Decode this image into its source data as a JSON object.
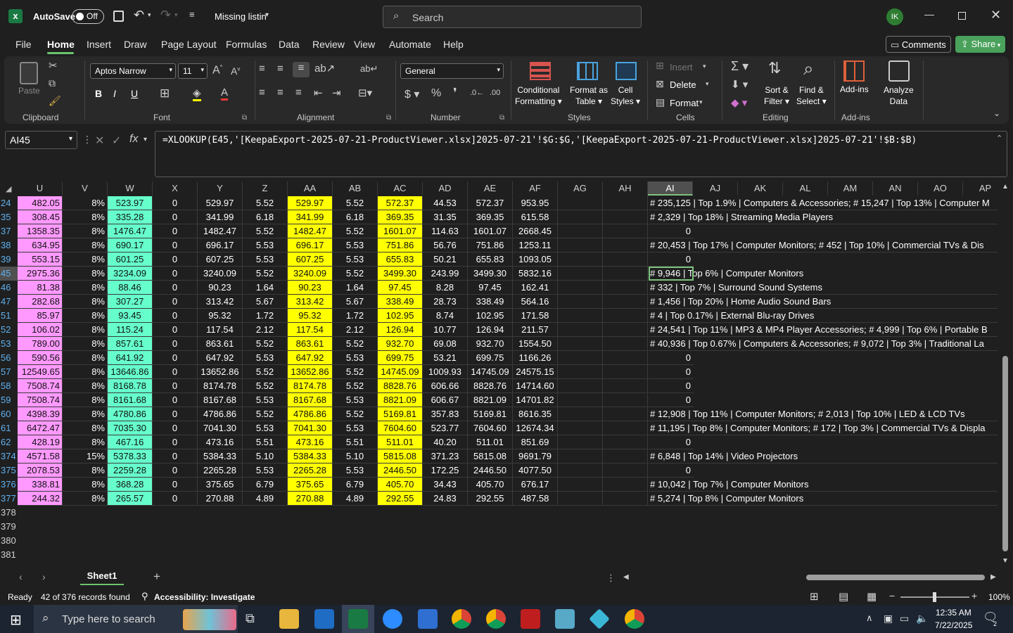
{
  "titlebar": {
    "autosave_label": "AutoSave",
    "autosave_state": "Off",
    "filename": "Missing listin",
    "search_placeholder": "Search",
    "avatar": "IK"
  },
  "menu": [
    "File",
    "Home",
    "Insert",
    "Draw",
    "Page Layout",
    "Formulas",
    "Data",
    "Review",
    "View",
    "Automate",
    "Help"
  ],
  "menu_right": {
    "comments": "Comments",
    "share": "Share"
  },
  "ribbon": {
    "paste": "Paste",
    "font_name": "Aptos Narrow",
    "font_size": "11",
    "number_format": "General",
    "conditional": "Conditional",
    "formatting": "Formatting",
    "format_as": "Format as",
    "table": "Table",
    "cell": "Cell",
    "styles": "Styles",
    "insert": "Insert",
    "delete": "Delete",
    "format": "Format",
    "sort": "Sort &",
    "filter": "Filter",
    "find": "Find &",
    "select": "Select",
    "addins": "Add-ins",
    "analyze": "Analyze",
    "data": "Data",
    "groups": [
      "Clipboard",
      "Font",
      "Alignment",
      "Number",
      "Styles",
      "Cells",
      "Editing",
      "Add-ins"
    ]
  },
  "namebox": "AI45",
  "formula": "=XLOOKUP(E45,'[KeepaExport-2025-07-21-ProductViewer.xlsx]2025-07-21'!$G:$G,'[KeepaExport-2025-07-21-ProductViewer.xlsx]2025-07-21'!$B:$B)",
  "columns": [
    "U",
    "V",
    "W",
    "X",
    "Y",
    "Z",
    "AA",
    "AB",
    "AC",
    "AD",
    "AE",
    "AF",
    "AG",
    "AH",
    "AI",
    "AJ",
    "AK",
    "AL",
    "AM",
    "AN",
    "AO",
    "AP"
  ],
  "rows": [
    {
      "n": "24",
      "u": "482.05",
      "v": "8%",
      "w": "523.97",
      "x": "0",
      "y": "529.97",
      "z": "5.52",
      "aa": "529.97",
      "ab": "5.52",
      "ac": "572.37",
      "ad": "44.53",
      "ae": "572.37",
      "af": "953.95",
      "ai": "# 235,125 | Top 1.9% | Computers & Accessories; # 15,247 | Top 13% | Computer M"
    },
    {
      "n": "35",
      "u": "308.45",
      "v": "8%",
      "w": "335.28",
      "x": "0",
      "y": "341.99",
      "z": "6.18",
      "aa": "341.99",
      "ab": "6.18",
      "ac": "369.35",
      "ad": "31.35",
      "ae": "369.35",
      "af": "615.58",
      "ai": "# 2,329 | Top 18% | Streaming Media Players"
    },
    {
      "n": "37",
      "u": "1358.35",
      "v": "8%",
      "w": "1476.47",
      "x": "0",
      "y": "1482.47",
      "z": "5.52",
      "aa": "1482.47",
      "ab": "5.52",
      "ac": "1601.07",
      "ad": "114.63",
      "ae": "1601.07",
      "af": "2668.45",
      "ai": "0"
    },
    {
      "n": "38",
      "u": "634.95",
      "v": "8%",
      "w": "690.17",
      "x": "0",
      "y": "696.17",
      "z": "5.53",
      "aa": "696.17",
      "ab": "5.53",
      "ac": "751.86",
      "ad": "56.76",
      "ae": "751.86",
      "af": "1253.11",
      "ai": "# 20,453 | Top 17% | Computer Monitors; # 452 | Top 10% | Commercial TVs & Dis"
    },
    {
      "n": "39",
      "u": "553.15",
      "v": "8%",
      "w": "601.25",
      "x": "0",
      "y": "607.25",
      "z": "5.53",
      "aa": "607.25",
      "ab": "5.53",
      "ac": "655.83",
      "ad": "50.21",
      "ae": "655.83",
      "af": "1093.05",
      "ai": "0"
    },
    {
      "n": "45",
      "u": "2975.36",
      "v": "8%",
      "w": "3234.09",
      "x": "0",
      "y": "3240.09",
      "z": "5.52",
      "aa": "3240.09",
      "ab": "5.52",
      "ac": "3499.30",
      "ad": "243.99",
      "ae": "3499.30",
      "af": "5832.16",
      "ai": "# 9,946 | Top 6% | Computer Monitors"
    },
    {
      "n": "46",
      "u": "81.38",
      "v": "8%",
      "w": "88.46",
      "x": "0",
      "y": "90.23",
      "z": "1.64",
      "aa": "90.23",
      "ab": "1.64",
      "ac": "97.45",
      "ad": "8.28",
      "ae": "97.45",
      "af": "162.41",
      "ai": "# 332 | Top 7% | Surround Sound Systems"
    },
    {
      "n": "47",
      "u": "282.68",
      "v": "8%",
      "w": "307.27",
      "x": "0",
      "y": "313.42",
      "z": "5.67",
      "aa": "313.42",
      "ab": "5.67",
      "ac": "338.49",
      "ad": "28.73",
      "ae": "338.49",
      "af": "564.16",
      "ai": "# 1,456 | Top 20% | Home Audio Sound Bars"
    },
    {
      "n": "51",
      "u": "85.97",
      "v": "8%",
      "w": "93.45",
      "x": "0",
      "y": "95.32",
      "z": "1.72",
      "aa": "95.32",
      "ab": "1.72",
      "ac": "102.95",
      "ad": "8.74",
      "ae": "102.95",
      "af": "171.58",
      "ai": "# 4 | Top 0.17% | External Blu-ray Drives"
    },
    {
      "n": "52",
      "u": "106.02",
      "v": "8%",
      "w": "115.24",
      "x": "0",
      "y": "117.54",
      "z": "2.12",
      "aa": "117.54",
      "ab": "2.12",
      "ac": "126.94",
      "ad": "10.77",
      "ae": "126.94",
      "af": "211.57",
      "ai": "# 24,541 | Top 11% | MP3 & MP4 Player Accessories; # 4,999 | Top 6% | Portable B"
    },
    {
      "n": "53",
      "u": "789.00",
      "v": "8%",
      "w": "857.61",
      "x": "0",
      "y": "863.61",
      "z": "5.52",
      "aa": "863.61",
      "ab": "5.52",
      "ac": "932.70",
      "ad": "69.08",
      "ae": "932.70",
      "af": "1554.50",
      "ai": "# 40,936 | Top 0.67% | Computers & Accessories; # 9,072 | Top 3% | Traditional La"
    },
    {
      "n": "56",
      "u": "590.56",
      "v": "8%",
      "w": "641.92",
      "x": "0",
      "y": "647.92",
      "z": "5.53",
      "aa": "647.92",
      "ab": "5.53",
      "ac": "699.75",
      "ad": "53.21",
      "ae": "699.75",
      "af": "1166.26",
      "ai": "0"
    },
    {
      "n": "57",
      "u": "12549.65",
      "v": "8%",
      "w": "13646.86",
      "x": "0",
      "y": "13652.86",
      "z": "5.52",
      "aa": "13652.86",
      "ab": "5.52",
      "ac": "14745.09",
      "ad": "1009.93",
      "ae": "14745.09",
      "af": "24575.15",
      "ai": "0"
    },
    {
      "n": "58",
      "u": "7508.74",
      "v": "8%",
      "w": "8168.78",
      "x": "0",
      "y": "8174.78",
      "z": "5.52",
      "aa": "8174.78",
      "ab": "5.52",
      "ac": "8828.76",
      "ad": "606.66",
      "ae": "8828.76",
      "af": "14714.60",
      "ai": "0"
    },
    {
      "n": "59",
      "u": "7508.74",
      "v": "8%",
      "w": "8161.68",
      "x": "0",
      "y": "8167.68",
      "z": "5.53",
      "aa": "8167.68",
      "ab": "5.53",
      "ac": "8821.09",
      "ad": "606.67",
      "ae": "8821.09",
      "af": "14701.82",
      "ai": "0"
    },
    {
      "n": "60",
      "u": "4398.39",
      "v": "8%",
      "w": "4780.86",
      "x": "0",
      "y": "4786.86",
      "z": "5.52",
      "aa": "4786.86",
      "ab": "5.52",
      "ac": "5169.81",
      "ad": "357.83",
      "ae": "5169.81",
      "af": "8616.35",
      "ai": "# 12,908 | Top 11% | Computer Monitors; # 2,013 | Top 10% | LED & LCD TVs"
    },
    {
      "n": "61",
      "u": "6472.47",
      "v": "8%",
      "w": "7035.30",
      "x": "0",
      "y": "7041.30",
      "z": "5.53",
      "aa": "7041.30",
      "ab": "5.53",
      "ac": "7604.60",
      "ad": "523.77",
      "ae": "7604.60",
      "af": "12674.34",
      "ai": "# 11,195 | Top 8% | Computer Monitors; # 172 | Top 3% | Commercial TVs & Displa"
    },
    {
      "n": "62",
      "u": "428.19",
      "v": "8%",
      "w": "467.16",
      "x": "0",
      "y": "473.16",
      "z": "5.51",
      "aa": "473.16",
      "ab": "5.51",
      "ac": "511.01",
      "ad": "40.20",
      "ae": "511.01",
      "af": "851.69",
      "ai": "0"
    },
    {
      "n": "374",
      "u": "4571.58",
      "v": "15%",
      "w": "5378.33",
      "x": "0",
      "y": "5384.33",
      "z": "5.10",
      "aa": "5384.33",
      "ab": "5.10",
      "ac": "5815.08",
      "ad": "371.23",
      "ae": "5815.08",
      "af": "9691.79",
      "ai": "# 6,848 | Top 14% | Video Projectors"
    },
    {
      "n": "375",
      "u": "2078.53",
      "v": "8%",
      "w": "2259.28",
      "x": "0",
      "y": "2265.28",
      "z": "5.53",
      "aa": "2265.28",
      "ab": "5.53",
      "ac": "2446.50",
      "ad": "172.25",
      "ae": "2446.50",
      "af": "4077.50",
      "ai": "0"
    },
    {
      "n": "376",
      "u": "338.81",
      "v": "8%",
      "w": "368.28",
      "x": "0",
      "y": "375.65",
      "z": "6.79",
      "aa": "375.65",
      "ab": "6.79",
      "ac": "405.70",
      "ad": "34.43",
      "ae": "405.70",
      "af": "676.17",
      "ai": "# 10,042 | Top 7% | Computer Monitors"
    },
    {
      "n": "377",
      "u": "244.32",
      "v": "8%",
      "w": "265.57",
      "x": "0",
      "y": "270.88",
      "z": "4.89",
      "aa": "270.88",
      "ab": "4.89",
      "ac": "292.55",
      "ad": "24.83",
      "ae": "292.55",
      "af": "487.58",
      "ai": "# 5,274 | Top 8% | Computer Monitors"
    }
  ],
  "empty_rows": [
    "378",
    "379",
    "380",
    "381"
  ],
  "sheet_tab": "Sheet1",
  "status": {
    "ready": "Ready",
    "records": "42 of 376 records found",
    "accessibility": "Accessibility: Investigate",
    "zoom": "100%"
  },
  "taskbar": {
    "search_placeholder": "Type here to search",
    "time": "12:35 AM",
    "date": "7/22/2025",
    "notif_count": "2"
  },
  "colors": {
    "pink": "#ff99ff",
    "green": "#66ffcc",
    "yellow": "#ffff00",
    "excel_green": "#1a7a43",
    "share": "#4aa15b"
  }
}
